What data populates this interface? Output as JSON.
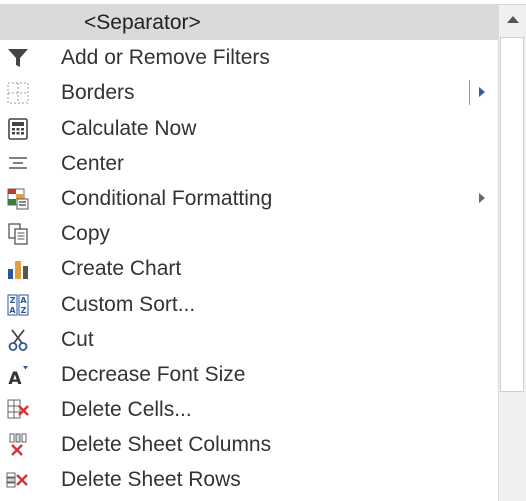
{
  "colors": {
    "selected_bg": "#dadada",
    "text": "#333333",
    "submenu_arrow_active": "#3a5aa8",
    "submenu_arrow_inactive": "#666666"
  },
  "command_list": {
    "items": [
      {
        "label": "<Separator>",
        "icon": "none",
        "selected": true
      },
      {
        "label": "Add or Remove Filters",
        "icon": "filter-icon"
      },
      {
        "label": "Borders",
        "icon": "borders-icon",
        "submenu": true,
        "split": true
      },
      {
        "label": "Calculate Now",
        "icon": "calculator-icon"
      },
      {
        "label": "Center",
        "icon": "align-center-icon"
      },
      {
        "label": "Conditional Formatting",
        "icon": "conditional-formatting-icon",
        "submenu": true
      },
      {
        "label": "Copy",
        "icon": "copy-icon"
      },
      {
        "label": "Create Chart",
        "icon": "chart-icon"
      },
      {
        "label": "Custom Sort...",
        "icon": "sort-icon"
      },
      {
        "label": "Cut",
        "icon": "scissors-icon"
      },
      {
        "label": "Decrease Font Size",
        "icon": "decrease-font-icon"
      },
      {
        "label": "Delete Cells...",
        "icon": "delete-cells-icon"
      },
      {
        "label": "Delete Sheet Columns",
        "icon": "delete-columns-icon"
      },
      {
        "label": "Delete Sheet Rows",
        "icon": "delete-rows-icon"
      }
    ]
  }
}
